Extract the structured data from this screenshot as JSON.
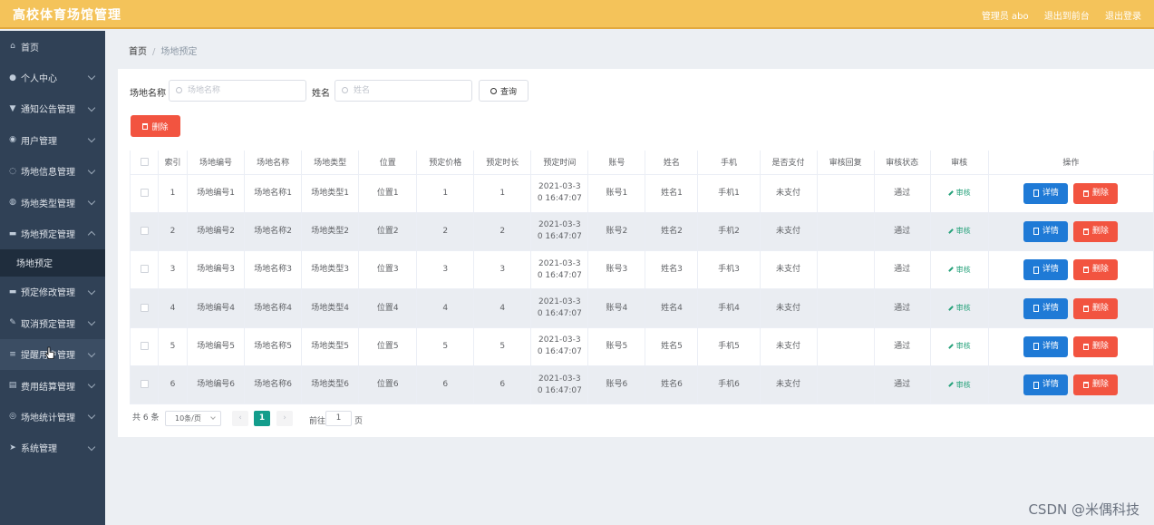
{
  "header": {
    "app_title": "高校体育场馆管理",
    "admin_label": "管理员 abo",
    "back_label": "退出到前台",
    "logout_label": "退出登录"
  },
  "sidebar": {
    "items": [
      {
        "label": "首页",
        "icon": "home-icon",
        "expandable": false
      },
      {
        "label": "个人中心",
        "icon": "user-icon",
        "expandable": true
      },
      {
        "label": "通知公告管理",
        "icon": "notice-icon",
        "expandable": true
      },
      {
        "label": "用户管理",
        "icon": "location-icon",
        "expandable": true
      },
      {
        "label": "场地信息管理",
        "icon": "power-icon",
        "expandable": true
      },
      {
        "label": "场地类型管理",
        "icon": "bulb-icon",
        "expandable": true
      },
      {
        "label": "场地预定管理",
        "icon": "monitor-icon",
        "expandable": true,
        "open": true
      },
      {
        "label": "场地预定",
        "sub": true
      },
      {
        "label": "预定修改管理",
        "icon": "folder-icon",
        "expandable": true
      },
      {
        "label": "取消预定管理",
        "icon": "edit-icon",
        "expandable": true
      },
      {
        "label": "提醒用户管理",
        "icon": "list-icon",
        "expandable": true,
        "hover": true
      },
      {
        "label": "费用结算管理",
        "icon": "wallet-icon",
        "expandable": true
      },
      {
        "label": "场地统计管理",
        "icon": "globe-icon",
        "expandable": true
      },
      {
        "label": "系统管理",
        "icon": "send-icon",
        "expandable": true
      }
    ]
  },
  "breadcrumb": {
    "home": "首页",
    "sep": "/",
    "current": "场地预定"
  },
  "search": {
    "venue_name_label": "场地名称",
    "venue_name_placeholder": "场地名称",
    "name_label": "姓名",
    "name_placeholder": "姓名",
    "query_label": "查询"
  },
  "toolbar": {
    "delete_label": "删除"
  },
  "table": {
    "columns": [
      "",
      "索引",
      "场地编号",
      "场地名称",
      "场地类型",
      "位置",
      "预定价格",
      "预定时长",
      "预定时间",
      "账号",
      "姓名",
      "手机",
      "是否支付",
      "审核回复",
      "审核状态",
      "审核",
      "操作"
    ],
    "audit_link": "审核",
    "detail_label": "详情",
    "delete_label": "删除",
    "rows": [
      {
        "index": "1",
        "code": "场地编号1",
        "name": "场地名称1",
        "type": "场地类型1",
        "location": "位置1",
        "price": "1",
        "duration": "1",
        "time_line1": "2021-03-3",
        "time_line2": "0 16:47:07",
        "account": "账号1",
        "person": "姓名1",
        "phone": "手机1",
        "paid": "未支付",
        "reply": "",
        "status": "通过"
      },
      {
        "index": "2",
        "code": "场地编号2",
        "name": "场地名称2",
        "type": "场地类型2",
        "location": "位置2",
        "price": "2",
        "duration": "2",
        "time_line1": "2021-03-3",
        "time_line2": "0 16:47:07",
        "account": "账号2",
        "person": "姓名2",
        "phone": "手机2",
        "paid": "未支付",
        "reply": "",
        "status": "通过"
      },
      {
        "index": "3",
        "code": "场地编号3",
        "name": "场地名称3",
        "type": "场地类型3",
        "location": "位置3",
        "price": "3",
        "duration": "3",
        "time_line1": "2021-03-3",
        "time_line2": "0 16:47:07",
        "account": "账号3",
        "person": "姓名3",
        "phone": "手机3",
        "paid": "未支付",
        "reply": "",
        "status": "通过"
      },
      {
        "index": "4",
        "code": "场地编号4",
        "name": "场地名称4",
        "type": "场地类型4",
        "location": "位置4",
        "price": "4",
        "duration": "4",
        "time_line1": "2021-03-3",
        "time_line2": "0 16:47:07",
        "account": "账号4",
        "person": "姓名4",
        "phone": "手机4",
        "paid": "未支付",
        "reply": "",
        "status": "通过"
      },
      {
        "index": "5",
        "code": "场地编号5",
        "name": "场地名称5",
        "type": "场地类型5",
        "location": "位置5",
        "price": "5",
        "duration": "5",
        "time_line1": "2021-03-3",
        "time_line2": "0 16:47:07",
        "account": "账号5",
        "person": "姓名5",
        "phone": "手机5",
        "paid": "未支付",
        "reply": "",
        "status": "通过"
      },
      {
        "index": "6",
        "code": "场地编号6",
        "name": "场地名称6",
        "type": "场地类型6",
        "location": "位置6",
        "price": "6",
        "duration": "6",
        "time_line1": "2021-03-3",
        "time_line2": "0 16:47:07",
        "account": "账号6",
        "person": "姓名6",
        "phone": "手机6",
        "paid": "未支付",
        "reply": "",
        "status": "通过"
      }
    ]
  },
  "pagination": {
    "total": "共 6 条",
    "page_size": "10条/页",
    "prev": "‹",
    "current_page": "1",
    "next": "›",
    "goto_label": "前往",
    "goto_value": "1",
    "page_suffix": "页"
  },
  "watermark": "CSDN @米偶科技",
  "colors": {
    "header": "#f4c35a",
    "sidebar": "#304156",
    "danger": "#f25440",
    "primary": "#1f7ad6",
    "pager_active": "#139d8c",
    "audit_link": "#27a27b"
  }
}
